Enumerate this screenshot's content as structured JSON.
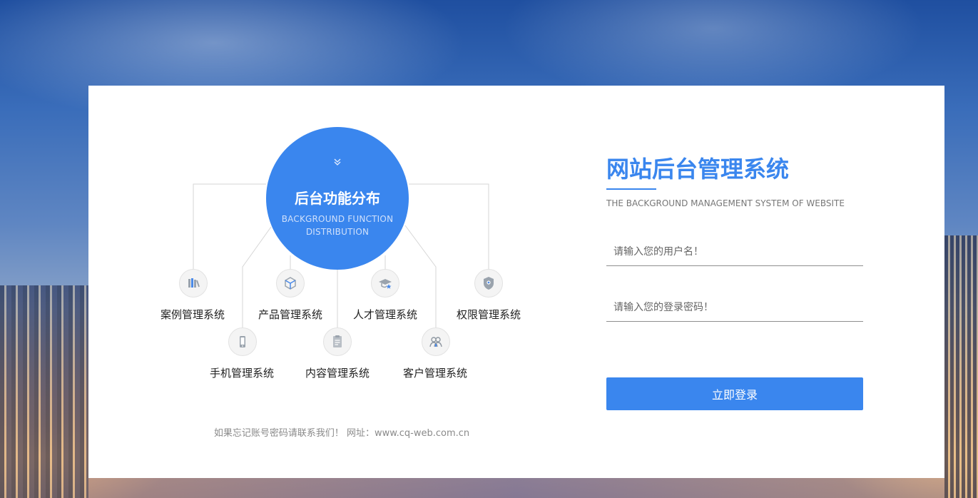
{
  "colors": {
    "accent": "#3a86ee"
  },
  "diagram": {
    "center_title": "后台功能分布",
    "center_subtitle": "BACKGROUND FUNCTION DISTRIBUTION",
    "center_chevron": "double-chevron-down-icon",
    "nodes": [
      {
        "label": "案例管理系统",
        "icon": "books-icon"
      },
      {
        "label": "产品管理系统",
        "icon": "cube-icon"
      },
      {
        "label": "人才管理系统",
        "icon": "graduation-cap-icon"
      },
      {
        "label": "权限管理系统",
        "icon": "shield-icon"
      },
      {
        "label": "手机管理系统",
        "icon": "mobile-phone-icon"
      },
      {
        "label": "内容管理系统",
        "icon": "document-icon"
      },
      {
        "label": "客户管理系统",
        "icon": "users-icon"
      }
    ],
    "footer_note": "如果忘记账号密码请联系我们！ 网址：www.cq-web.com.cn"
  },
  "login": {
    "title": "网站后台管理系统",
    "subtitle": "THE BACKGROUND MANAGEMENT SYSTEM OF WEBSITE",
    "username_placeholder": "请输入您的用户名！",
    "password_placeholder": "请输入您的登录密码！",
    "submit_label": "立即登录"
  }
}
